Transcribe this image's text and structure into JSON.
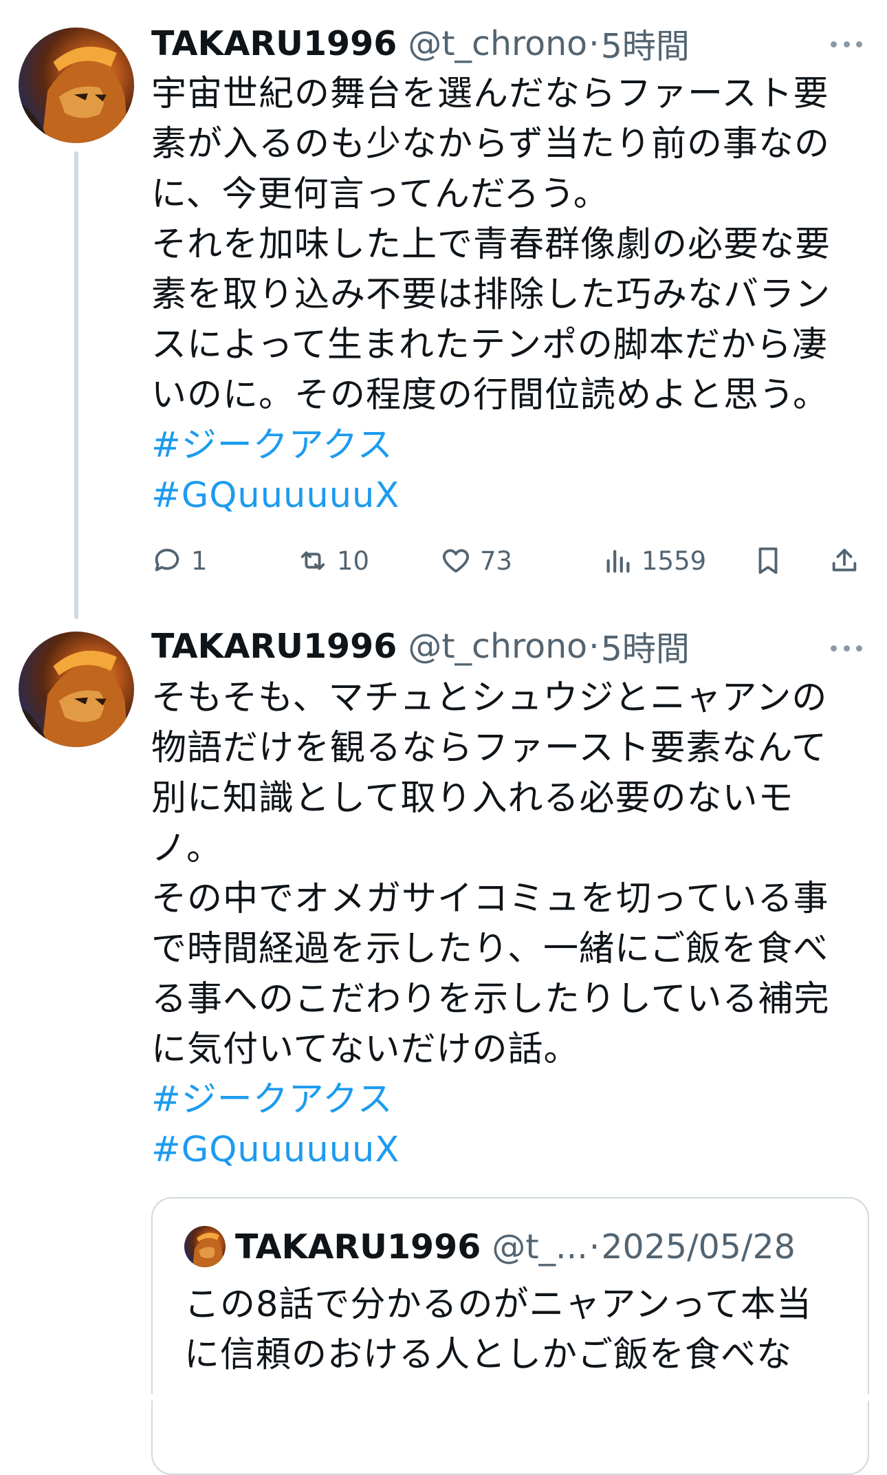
{
  "tweet1": {
    "name": "TAKARU1996",
    "handle": "@t_chrono",
    "separator": "·",
    "time": "5時間",
    "lines": [
      "宇宙世紀の舞台を選んだならファースト要",
      "素が入るのも少なからず当たり前の事なの",
      "に、今更何言ってんだろう。",
      "それを加味した上で青春群像劇の必要な要",
      "素を取り込み不要は排除した巧みなバラン",
      "スによって生まれたテンポの脚本だから凄",
      "いのに。その程度の行間位読めよと思う。"
    ],
    "hashtags": [
      "#ジークアクス",
      "#GQuuuuuuX"
    ],
    "replies": "1",
    "reposts": "10",
    "likes": "73",
    "views": "1559"
  },
  "tweet2": {
    "name": "TAKARU1996",
    "handle": "@t_chrono",
    "separator": "·",
    "time": "5時間",
    "lines": [
      "そもそも、マチュとシュウジとニャアンの",
      "物語だけを観るならファースト要素なんて",
      "別に知識として取り入れる必要のないモ",
      "ノ。",
      "その中でオメガサイコミュを切っている事",
      "で時間経過を示したり、一緒にご飯を食べ",
      "る事へのこだわりを示したりしている補完",
      "に気付いてないだけの話。"
    ],
    "hashtags": [
      "#ジークアクス",
      "#GQuuuuuuX"
    ]
  },
  "quote": {
    "name": "TAKARU1996",
    "handle": "@t_...",
    "separator": "·",
    "date": "2025/05/28",
    "lines": [
      "この8話で分かるのがニャアンって本当",
      "に信頼のおける人としかご飯を食べな"
    ]
  },
  "icons": {
    "more": "more-horizontal-icon",
    "reply": "reply-icon",
    "repost": "repost-icon",
    "like": "heart-icon",
    "views": "views-icon",
    "bookmark": "bookmark-icon",
    "share": "share-icon"
  },
  "colors": {
    "hashtag": "#1d9bf0",
    "secondary": "#536471",
    "thread_line": "#cfd9de"
  }
}
